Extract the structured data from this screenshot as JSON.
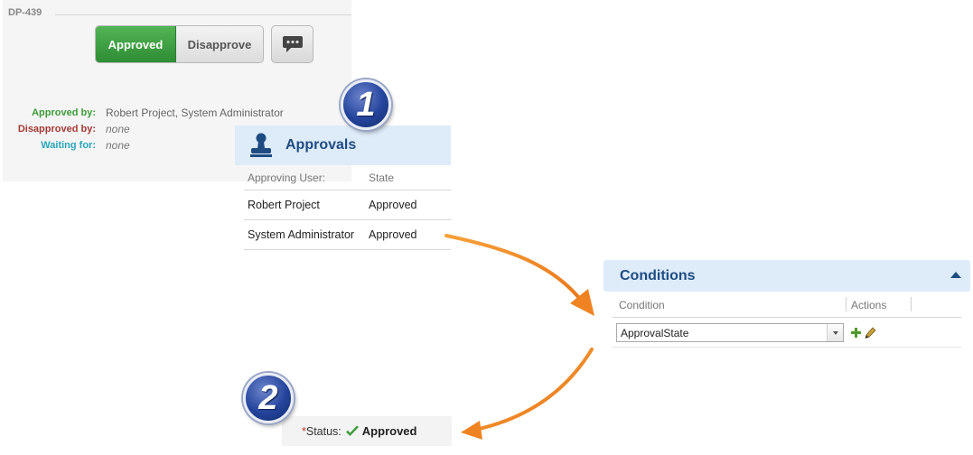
{
  "issue": {
    "key": "DP-439",
    "approve_button": "Approved",
    "disapprove_button": "Disapprove",
    "comment_icon": "speech-bubble-icon",
    "approved_by_label": "Approved by:",
    "approved_by_value": "Robert Project, System Administrator",
    "disapproved_by_label": "Disapproved by:",
    "disapproved_by_value": "none",
    "waiting_for_label": "Waiting for:",
    "waiting_for_value": "none"
  },
  "badges": {
    "first": "1",
    "second": "2"
  },
  "approvals": {
    "title": "Approvals",
    "icon": "stamp-icon",
    "columns": [
      "Approving User:",
      "State"
    ],
    "rows": [
      {
        "user": "Robert Project",
        "state": "Approved"
      },
      {
        "user": "System Administrator",
        "state": "Approved"
      }
    ]
  },
  "conditions": {
    "title": "Conditions",
    "columns": [
      "Condition",
      "Actions"
    ],
    "selected_condition": "ApprovalState"
  },
  "status": {
    "required_mark": "*",
    "label": "Status:",
    "value": "Approved"
  },
  "colors": {
    "approved_green": "#3f9b3a",
    "disapproved_red": "#a33a35",
    "waiting_cyan": "#28a6b8",
    "header_blue": "#1e4c82",
    "arrow_orange": "#f28a1e"
  }
}
